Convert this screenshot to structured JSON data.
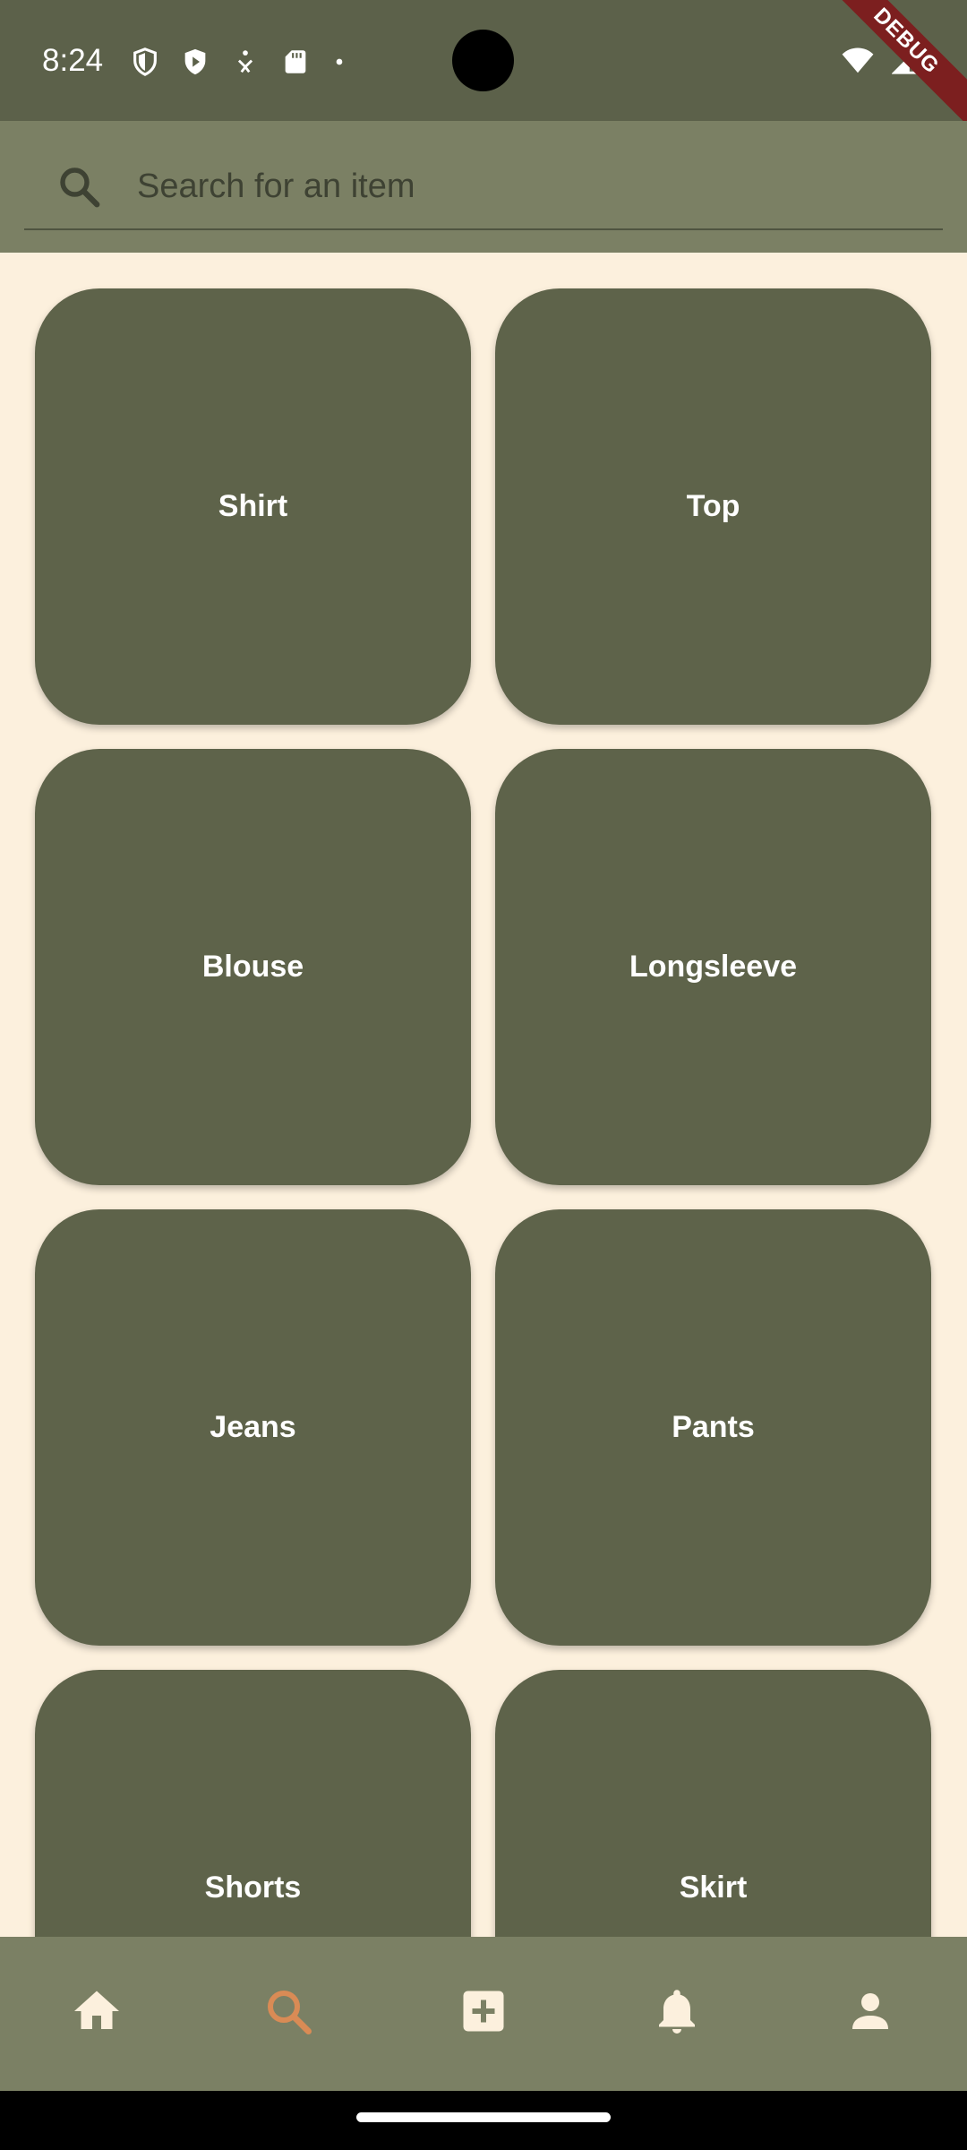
{
  "status_bar": {
    "time": "8:24",
    "left_icons": [
      "shield-icon",
      "play-protect-icon",
      "accessibility-icon",
      "sd-card-icon",
      "dot-icon"
    ],
    "right_icons": [
      "wifi-icon",
      "signal-icon"
    ],
    "debug_label": "DEBUG"
  },
  "search": {
    "placeholder": "Search for an item",
    "icon": "search-icon"
  },
  "categories": [
    {
      "label": "Shirt"
    },
    {
      "label": "Top"
    },
    {
      "label": "Blouse"
    },
    {
      "label": "Longsleeve"
    },
    {
      "label": "Jeans"
    },
    {
      "label": "Pants"
    },
    {
      "label": "Shorts"
    },
    {
      "label": "Skirt"
    }
  ],
  "bottom_nav": {
    "items": [
      {
        "name": "home",
        "icon": "home-icon",
        "active": false
      },
      {
        "name": "search",
        "icon": "search-icon",
        "active": true
      },
      {
        "name": "add",
        "icon": "add-box-icon",
        "active": false
      },
      {
        "name": "notifications",
        "icon": "bell-icon",
        "active": false
      },
      {
        "name": "profile",
        "icon": "person-icon",
        "active": false
      }
    ]
  },
  "colors": {
    "background": "#fcf0dd",
    "status_bar": "#5c614a",
    "app_bar": "#7b8064",
    "tile": "#5e634a",
    "active_nav": "#d98b55",
    "inactive_nav": "#fcf0dd"
  }
}
